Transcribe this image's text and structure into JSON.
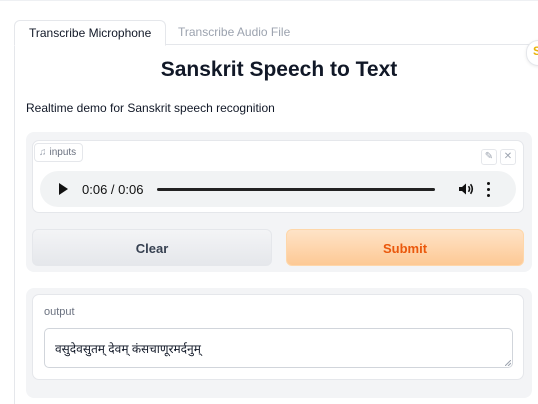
{
  "tabs": [
    {
      "label": "Transcribe Microphone",
      "active": true
    },
    {
      "label": "Transcribe Audio File",
      "active": false
    }
  ],
  "page": {
    "title": "Sanskrit Speech to Text",
    "description": "Realtime demo for Sanskrit speech recognition"
  },
  "input": {
    "label": "inputs",
    "label_icon": "music-note-icon",
    "tools": [
      "edit-icon",
      "close-icon"
    ]
  },
  "player": {
    "time": "0:06 / 0:06",
    "progress": 1.0
  },
  "buttons": {
    "clear": "Clear",
    "submit": "Submit"
  },
  "output": {
    "label": "output",
    "value": "वसुदेवसुतम् देवम् कंसचाणूरमर्दनुम्"
  },
  "colors": {
    "submit_text": "#ea580c",
    "submit_bg": "#fdc995",
    "accent_badge": "#eab308"
  }
}
